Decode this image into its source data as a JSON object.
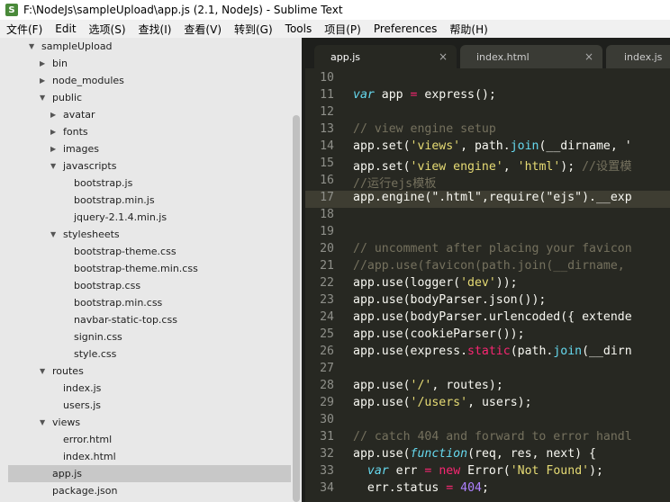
{
  "window": {
    "title": "F:\\NodeJs\\sampleUpload\\app.js (2.1, NodeJs) - Sublime Text"
  },
  "menu": [
    "文件(F)",
    "Edit",
    "选项(S)",
    "查找(I)",
    "查看(V)",
    "转到(G)",
    "Tools",
    "项目(P)",
    "Preferences",
    "帮助(H)"
  ],
  "tabs": [
    {
      "label": "app.js",
      "close": "×"
    },
    {
      "label": "index.html",
      "close": "×"
    },
    {
      "label": "index.js",
      "close": "×"
    }
  ],
  "tree": [
    {
      "label": "sampleUpload",
      "arrow": "▼",
      "indent": 0
    },
    {
      "label": "bin",
      "arrow": "▶",
      "indent": 1
    },
    {
      "label": "node_modules",
      "arrow": "▶",
      "indent": 1
    },
    {
      "label": "public",
      "arrow": "▼",
      "indent": 1
    },
    {
      "label": "avatar",
      "arrow": "▶",
      "indent": 2
    },
    {
      "label": "fonts",
      "arrow": "▶",
      "indent": 2
    },
    {
      "label": "images",
      "arrow": "▶",
      "indent": 2
    },
    {
      "label": "javascripts",
      "arrow": "▼",
      "indent": 2
    },
    {
      "label": "bootstrap.js",
      "arrow": "",
      "indent": 3
    },
    {
      "label": "bootstrap.min.js",
      "arrow": "",
      "indent": 3
    },
    {
      "label": "jquery-2.1.4.min.js",
      "arrow": "",
      "indent": 3
    },
    {
      "label": "stylesheets",
      "arrow": "▼",
      "indent": 2
    },
    {
      "label": "bootstrap-theme.css",
      "arrow": "",
      "indent": 3
    },
    {
      "label": "bootstrap-theme.min.css",
      "arrow": "",
      "indent": 3
    },
    {
      "label": "bootstrap.css",
      "arrow": "",
      "indent": 3
    },
    {
      "label": "bootstrap.min.css",
      "arrow": "",
      "indent": 3
    },
    {
      "label": "navbar-static-top.css",
      "arrow": "",
      "indent": 3
    },
    {
      "label": "signin.css",
      "arrow": "",
      "indent": 3
    },
    {
      "label": "style.css",
      "arrow": "",
      "indent": 3
    },
    {
      "label": "routes",
      "arrow": "▼",
      "indent": 1
    },
    {
      "label": "index.js",
      "arrow": "",
      "indent": 2
    },
    {
      "label": "users.js",
      "arrow": "",
      "indent": 2
    },
    {
      "label": "views",
      "arrow": "▼",
      "indent": 1
    },
    {
      "label": "error.html",
      "arrow": "",
      "indent": 2
    },
    {
      "label": "index.html",
      "arrow": "",
      "indent": 2
    },
    {
      "label": "app.js",
      "arrow": "",
      "indent": 1,
      "selected": true
    },
    {
      "label": "package.json",
      "arrow": "",
      "indent": 1
    }
  ],
  "code": [
    {
      "n": "10",
      "t": []
    },
    {
      "n": "11",
      "t": [
        [
          "kw",
          "var"
        ],
        [
          "p",
          " app "
        ],
        [
          "op",
          "="
        ],
        [
          "p",
          " express();"
        ]
      ]
    },
    {
      "n": "12",
      "t": []
    },
    {
      "n": "13",
      "t": [
        [
          "cm",
          "// view engine setup"
        ]
      ]
    },
    {
      "n": "14",
      "t": [
        [
          "p",
          "app.set("
        ],
        [
          "str",
          "'views'"
        ],
        [
          "p",
          ", path."
        ],
        [
          "fn",
          "join"
        ],
        [
          "p",
          "(__dirname, '"
        ]
      ]
    },
    {
      "n": "15",
      "t": [
        [
          "p",
          "app.set("
        ],
        [
          "str",
          "'view engine'"
        ],
        [
          "p",
          ", "
        ],
        [
          "str",
          "'html'"
        ],
        [
          "p",
          "); "
        ],
        [
          "cm",
          "//设置模"
        ]
      ]
    },
    {
      "n": "16",
      "t": [
        [
          "cm",
          "//运行ejs模板"
        ]
      ]
    },
    {
      "n": "17",
      "t": [
        [
          "p",
          "app.engine(\".html\",require(\"ejs\").__exp"
        ]
      ],
      "current": true
    },
    {
      "n": "18",
      "t": []
    },
    {
      "n": "19",
      "t": []
    },
    {
      "n": "20",
      "t": [
        [
          "cm",
          "// uncomment after placing your favicon"
        ]
      ]
    },
    {
      "n": "21",
      "t": [
        [
          "cm",
          "//app.use(favicon(path.join(__dirname,"
        ]
      ]
    },
    {
      "n": "22",
      "t": [
        [
          "p",
          "app.use(logger("
        ],
        [
          "str",
          "'dev'"
        ],
        [
          "p",
          "));"
        ]
      ]
    },
    {
      "n": "23",
      "t": [
        [
          "p",
          "app.use(bodyParser.json());"
        ]
      ]
    },
    {
      "n": "24",
      "t": [
        [
          "p",
          "app.use(bodyParser.urlencoded({ extende"
        ]
      ]
    },
    {
      "n": "25",
      "t": [
        [
          "p",
          "app.use(cookieParser());"
        ]
      ]
    },
    {
      "n": "26",
      "t": [
        [
          "p",
          "app.use(express."
        ],
        [
          "nw",
          "static"
        ],
        [
          "p",
          "(path."
        ],
        [
          "fn",
          "join"
        ],
        [
          "p",
          "(__dirn"
        ]
      ]
    },
    {
      "n": "27",
      "t": []
    },
    {
      "n": "28",
      "t": [
        [
          "p",
          "app.use("
        ],
        [
          "str",
          "'/'"
        ],
        [
          "p",
          ", routes);"
        ]
      ]
    },
    {
      "n": "29",
      "t": [
        [
          "p",
          "app.use("
        ],
        [
          "str",
          "'/users'"
        ],
        [
          "p",
          ", users);"
        ]
      ]
    },
    {
      "n": "30",
      "t": []
    },
    {
      "n": "31",
      "t": [
        [
          "cm",
          "// catch 404 and forward to error handl"
        ]
      ]
    },
    {
      "n": "32",
      "t": [
        [
          "p",
          "app.use("
        ],
        [
          "kw",
          "function"
        ],
        [
          "p",
          "(req, res, next) {"
        ]
      ]
    },
    {
      "n": "33",
      "t": [
        [
          "p",
          "  "
        ],
        [
          "kw",
          "var"
        ],
        [
          "p",
          " err "
        ],
        [
          "op",
          "="
        ],
        [
          "p",
          " "
        ],
        [
          "nw",
          "new"
        ],
        [
          "p",
          " Error("
        ],
        [
          "str",
          "'Not Found'"
        ],
        [
          "p",
          ");"
        ]
      ]
    },
    {
      "n": "34",
      "t": [
        [
          "p",
          "  err.status "
        ],
        [
          "op",
          "="
        ],
        [
          "p",
          " "
        ],
        [
          "num",
          "404"
        ],
        [
          "p",
          ";"
        ]
      ]
    }
  ]
}
